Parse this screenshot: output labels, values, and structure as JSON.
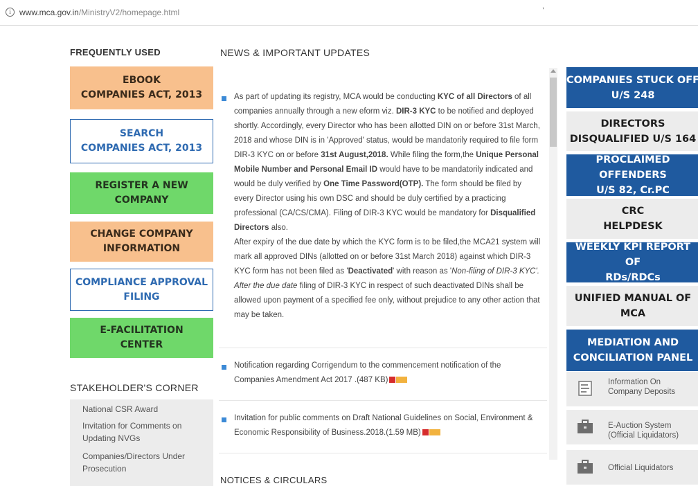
{
  "browser": {
    "info_icon": "info-circle-icon",
    "url_domain": "www.mca.gov.in",
    "url_path": "/MinistryV2/homepage.html"
  },
  "frequently_used": {
    "title": "FREQUENTLY USED",
    "buttons": [
      {
        "label": "EBOOK\nCOMPANIES ACT, 2013",
        "style": "orange"
      },
      {
        "label": "SEARCH\nCOMPANIES ACT, 2013",
        "style": "outline"
      },
      {
        "label": "REGISTER A NEW\nCOMPANY",
        "style": "green"
      },
      {
        "label": "CHANGE COMPANY\nINFORMATION",
        "style": "orange"
      },
      {
        "label": "COMPLIANCE APPROVAL\nFILING",
        "style": "outline"
      },
      {
        "label": "E-FACILITATION\nCENTER",
        "style": "green"
      }
    ]
  },
  "stakeholders": {
    "title": "STAKEHOLDER'S CORNER",
    "items": [
      "National CSR Award",
      "Invitation for Comments on Updating NVGs",
      "Companies/Directors Under Prosecution"
    ]
  },
  "news": {
    "title": "NEWS & IMPORTANT UPDATES",
    "item1": {
      "p1_a": "As part of updating its registry, MCA would be conducting ",
      "p1_b": "KYC of all Directors",
      "p1_c": " of all companies annually through a new eform viz. ",
      "p1_d": "DIR-3 KYC",
      "p1_e": " to be notified and deployed shortly. Accordingly, every Director who has been allotted DIN on or before 31st March, 2018 and whose DIN is in 'Approved' status, would be mandatorily required to file form DIR-3 KYC on or before ",
      "p1_f": "31st August,2018.",
      "p1_g": " While filing the form,the ",
      "p1_h": "Unique Personal Mobile Number and Personal Email ID",
      "p1_i": " would have to be mandatorily indicated and would be duly verified by ",
      "p1_j": "One Time Password(OTP).",
      "p1_k": " The form should be filed by every Director using his own DSC and should be duly certified by a practicing professional (CA/CS/CMA). Filing of DIR-3 KYC would be mandatory for ",
      "p1_l": "Disqualified Directors",
      "p1_m": " also.",
      "p2_a": "After expiry of the due date by which the KYC form is to be filed,the MCA21 system will mark all approved DINs (allotted on or before 31st March 2018) against which DIR-3 KYC form has not been filed as '",
      "p2_b": "Deactivated",
      "p2_c": "' with reason as '",
      "p2_d": "Non-filing of DIR-3 KYC'. After the due date",
      "p2_e": " filing of DIR-3 KYC in respect of such deactivated DINs shall be allowed upon payment of a specified fee only, without prejudice to any other action that may be taken."
    },
    "item2": "Notification regarding Corrigendum to the commencement notification of the Companies Amendment Act 2017 .(487 KB)",
    "item3": "Invitation for public comments on Draft National Guidelines on Social, Environment & Economic Responsibility of Business.2018.(1.59 MB)",
    "pdf_icon": "pdf-file-icon"
  },
  "notices": {
    "title": "NOTICES & CIRCULARS"
  },
  "right_panel": {
    "buttons": [
      {
        "label": "COMPANIES STUCK OFF\nU/S 248",
        "style": "blue"
      },
      {
        "label": "DIRECTORS\nDISQUALIFIED U/S 164",
        "style": "grey"
      },
      {
        "label": "PROCLAIMED OFFENDERS\nU/S 82, Cr.PC",
        "style": "blue"
      },
      {
        "label": "CRC\nHELPDESK",
        "style": "grey"
      },
      {
        "label": "WEEKLY KPI REPORT OF\nRDs/RDCs",
        "style": "blue"
      },
      {
        "label": "UNIFIED MANUAL OF\nMCA",
        "style": "grey"
      },
      {
        "label": "MEDIATION AND\nCONCILIATION PANEL",
        "style": "blue"
      }
    ],
    "links": [
      {
        "label": "Information On\nCompany Deposits",
        "icon": "document-icon"
      },
      {
        "label": "E-Auction System\n(Official Liquidators)",
        "icon": "briefcase-icon"
      },
      {
        "label": "Official Liquidators",
        "icon": "briefcase-icon"
      }
    ]
  },
  "colors": {
    "accent_blue": "#1f5a9f",
    "orange": "#f8c08d",
    "green": "#6fd86a",
    "bullet": "#3c8ad6"
  }
}
